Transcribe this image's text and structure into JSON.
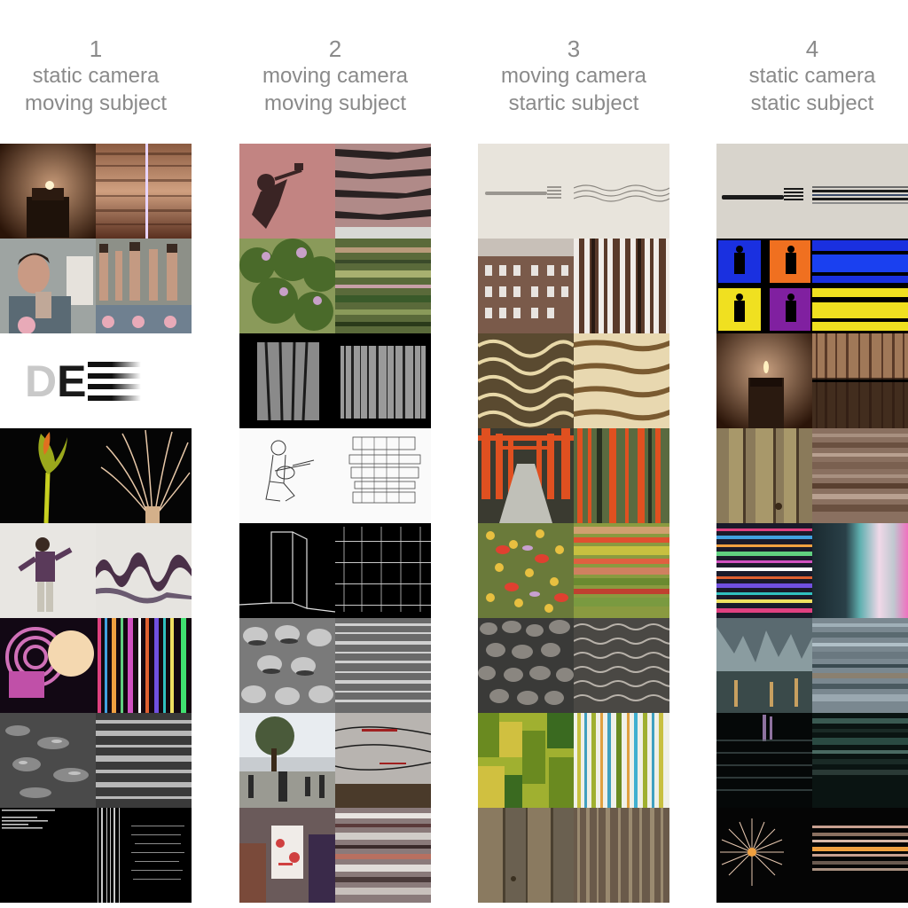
{
  "columns": [
    {
      "number": "1",
      "line1": "static camera",
      "line2": "moving subject"
    },
    {
      "number": "2",
      "line1": "moving camera",
      "line2": "moving subject"
    },
    {
      "number": "3",
      "line1": "moving camera",
      "line2": "startic subject"
    },
    {
      "number": "4",
      "line1": "static camera",
      "line2": "static subject"
    }
  ],
  "logo": {
    "d": "D",
    "e": "E"
  }
}
